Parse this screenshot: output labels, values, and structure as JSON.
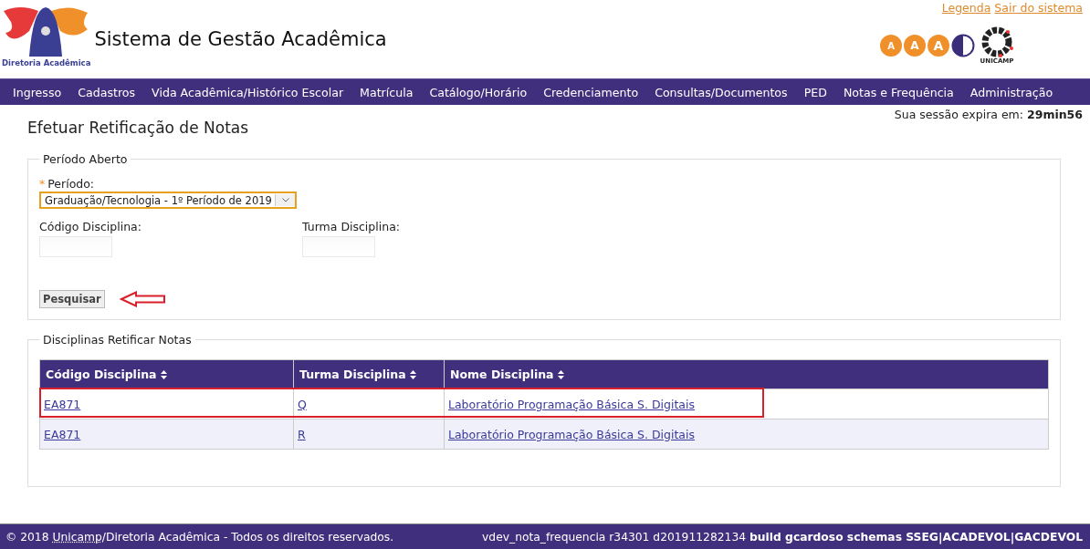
{
  "header": {
    "logo_caption": "Diretoria Acadêmica",
    "title": "Sistema de Gestão Acadêmica",
    "top_links": [
      "Legenda",
      "Sair do sistema"
    ],
    "font_buttons": [
      "A",
      "A",
      "A"
    ],
    "unicamp_caption": "UNICAMP"
  },
  "nav": {
    "items": [
      "Ingresso",
      "Cadastros",
      "Vida Acadêmica/Histórico Escolar",
      "Matrícula",
      "Catálogo/Horário",
      "Credenciamento",
      "Consultas/Documentos",
      "PED",
      "Notas e Frequência",
      "Administração"
    ]
  },
  "session": {
    "label": "Sua sessão expira em:",
    "time": "29min56"
  },
  "page_title": "Efetuar Retificação de Notas",
  "search_form": {
    "legend": "Período Aberto",
    "required_mark": "*",
    "period_label": "Período:",
    "period_value": "Graduação/Tecnologia - 1º Período de 2019",
    "code_label": "Código Disciplina:",
    "class_label": "Turma Disciplina:",
    "search_button": "Pesquisar",
    "arrow_annotation": true
  },
  "results": {
    "legend": "Disciplinas Retificar Notas",
    "columns": [
      "Código Disciplina",
      "Turma Disciplina",
      "Nome Disciplina"
    ],
    "rows": [
      {
        "cells": [
          "EA871",
          "Q",
          "Laboratório Programação Básica S. Digitais"
        ],
        "highlighted": true
      },
      {
        "cells": [
          "EA871",
          "R",
          "Laboratório Programação Básica S. Digitais"
        ],
        "highlighted": false
      }
    ]
  },
  "footer": {
    "copyright": "© 2018",
    "org_link": "Unicamp",
    "rights": "/Diretoria Acadêmica - Todos os direitos reservados.",
    "build_info": "vdev_nota_frequencia r34301 d201911282134",
    "build_bold": "build gcardoso schemas SSEG|ACADEVOL|GACDEVOL"
  }
}
